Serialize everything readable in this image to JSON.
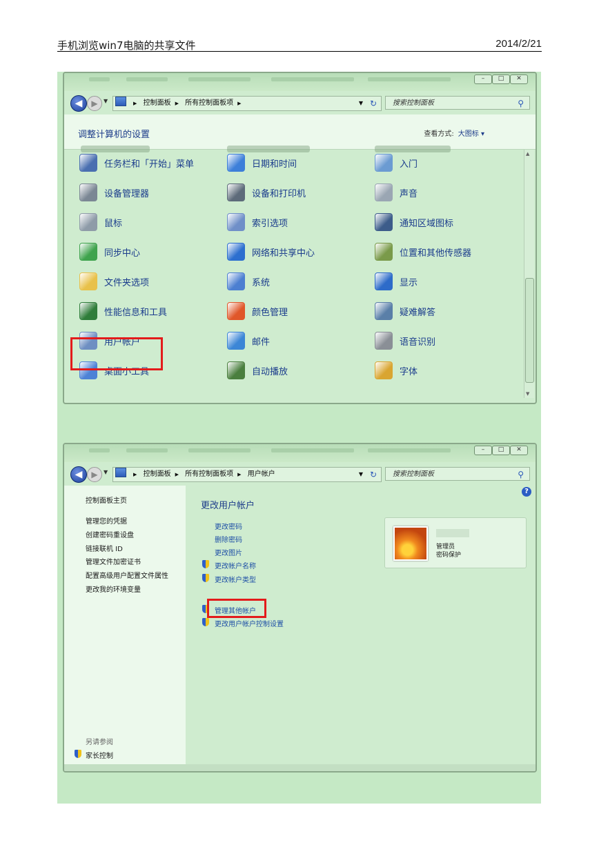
{
  "doc_header": {
    "title": "手机浏览win7电脑的共享文件",
    "date": "2014/2/21"
  },
  "window_buttons": {
    "min": "–",
    "max": "□",
    "close": "✕"
  },
  "window1": {
    "breadcrumb": [
      "控制面板",
      "所有控制面板项"
    ],
    "search_placeholder": "搜索控制面板",
    "page_title": "调整计算机的设置",
    "view_by_label": "查看方式:",
    "view_by_value": "大图标 ▾",
    "rows": [
      [
        "任务栏和「开始」菜单",
        "日期和时间",
        "入门"
      ],
      [
        "设备管理器",
        "设备和打印机",
        "声音"
      ],
      [
        "鼠标",
        "索引选项",
        "通知区域图标"
      ],
      [
        "同步中心",
        "网络和共享中心",
        "位置和其他传感器"
      ],
      [
        "文件夹选项",
        "系统",
        "显示"
      ],
      [
        "性能信息和工具",
        "颜色管理",
        "疑难解答"
      ],
      [
        "用户帐户",
        "邮件",
        "语音识别"
      ],
      [
        "桌面小工具",
        "自动播放",
        "字体"
      ]
    ],
    "icon_colors": [
      [
        "#4a6fb0",
        "#3d7fd9",
        "#6b9bd2"
      ],
      [
        "#7b8794",
        "#5d6b7a",
        "#9aa6b3"
      ],
      [
        "#8e9ba8",
        "#6f8fc8",
        "#3d5c8a"
      ],
      [
        "#3fa34d",
        "#2c6fcf",
        "#7a9a4a"
      ],
      [
        "#e8c14a",
        "#4c7fd1",
        "#2d6bc9"
      ],
      [
        "#2f7d3a",
        "#e0572a",
        "#5a7fa8"
      ],
      [
        "#6e8fc2",
        "#3c86d6",
        "#8a8f96"
      ],
      [
        "#4d82d6",
        "#4a7f3e",
        "#d9a531"
      ]
    ]
  },
  "window2": {
    "breadcrumb": [
      "控制面板",
      "所有控制面板项",
      "用户帐户"
    ],
    "search_placeholder": "搜索控制面板",
    "side_home": "控制面板主页",
    "side_links": [
      "管理您的凭据",
      "创建密码重设盘",
      "链接联机 ID",
      "管理文件加密证书",
      "配置高级用户配置文件属性",
      "更改我的环境变量"
    ],
    "see_also": "另请参阅",
    "parental": "家长控制",
    "main_title": "更改用户帐户",
    "actions": [
      "更改密码",
      "删除密码",
      "更改图片"
    ],
    "shield_actions": [
      "更改帐户名称",
      "更改帐户类型"
    ],
    "shield_actions2": [
      "管理其他帐户",
      "更改用户帐户控制设置"
    ],
    "account_role": "管理员",
    "account_status": "密码保护"
  }
}
